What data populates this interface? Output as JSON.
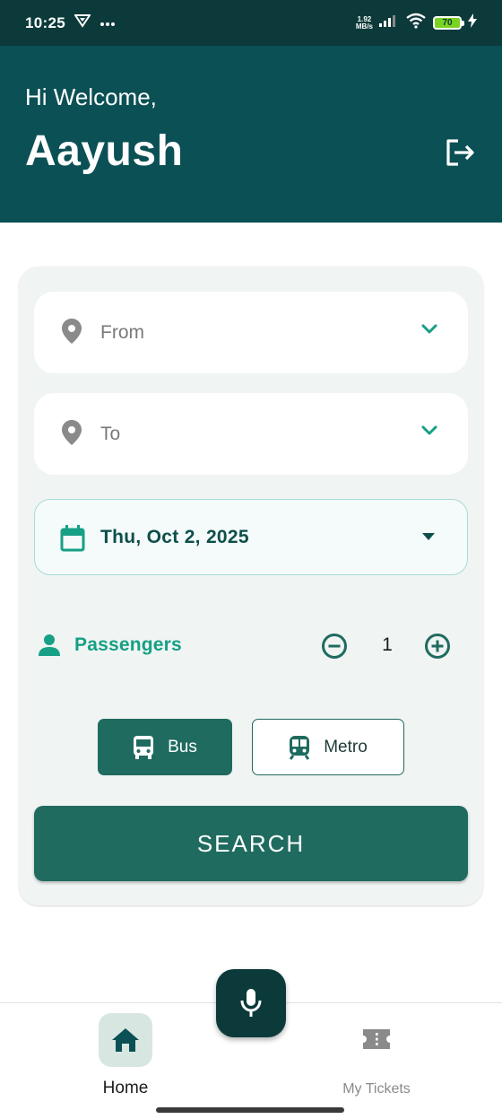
{
  "status_bar": {
    "time": "10:25",
    "net_speed_value": "1.92",
    "net_speed_unit": "MB/s",
    "battery_level": "70"
  },
  "header": {
    "greeting": "Hi Welcome,",
    "username": "Aayush"
  },
  "form": {
    "from_placeholder": "From",
    "to_placeholder": "To",
    "date_value": "Thu, Oct 2, 2025",
    "passengers_label": "Passengers",
    "passengers_count": "1",
    "mode_bus_label": "Bus",
    "mode_metro_label": "Metro",
    "selected_mode": "Bus",
    "search_label": "SEARCH"
  },
  "bottom_nav": {
    "home_label": "Home",
    "tickets_label": "My Tickets",
    "active": "Home"
  },
  "colors": {
    "header_bg": "#0b5054",
    "status_bg": "#0c3a3a",
    "primary": "#1f6b5f",
    "accent": "#16a085"
  }
}
